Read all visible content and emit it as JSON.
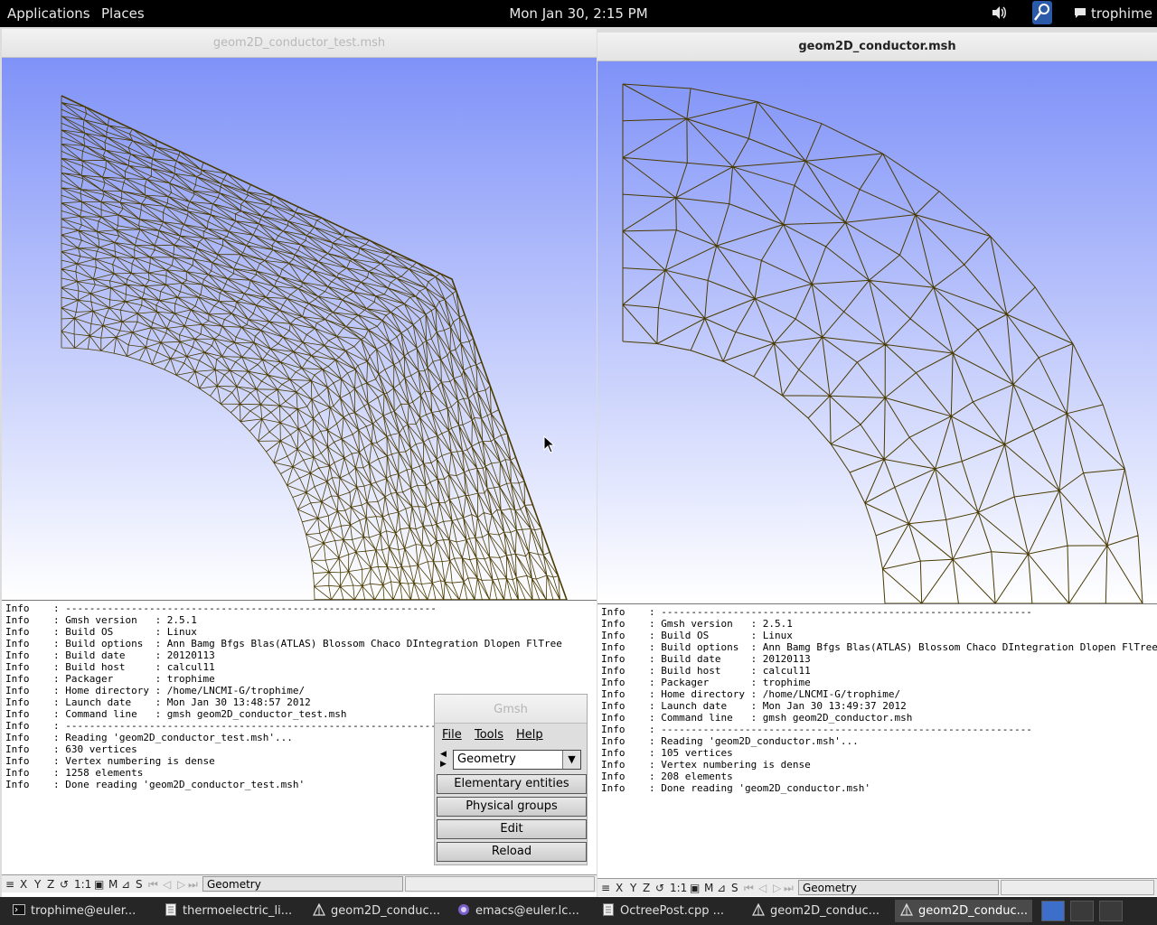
{
  "topbar": {
    "applications": "Applications",
    "places": "Places",
    "clock": "Mon Jan 30,  2:15 PM",
    "user": "trophime"
  },
  "left_window": {
    "title": "geom2D_conductor_test.msh",
    "console": [
      "Info    : --------------------------------------------------------------",
      "Info    : Gmsh version   : 2.5.1",
      "Info    : Build OS       : Linux",
      "Info    : Build options  : Ann Bamg Bfgs Blas(ATLAS) Blossom Chaco DIntegration Dlopen FlTree",
      "Info    : Build date     : 20120113",
      "Info    : Build host     : calcul11",
      "Info    : Packager       : trophime",
      "Info    : Home directory : /home/LNCMI-G/trophime/",
      "Info    : Launch date    : Mon Jan 30 13:48:57 2012",
      "Info    : Command line   : gmsh geom2D_conductor_test.msh",
      "Info    : --------------------------------------------------------------",
      "Info    : Reading 'geom2D_conductor_test.msh'...",
      "Info    : 630 vertices",
      "Info    : Vertex numbering is dense",
      "Info    : 1258 elements",
      "Info    : Done reading 'geom2D_conductor_test.msh'"
    ],
    "status_module": "Geometry"
  },
  "right_window": {
    "title": "geom2D_conductor.msh",
    "console": [
      "Info    : --------------------------------------------------------------",
      "Info    : Gmsh version   : 2.5.1",
      "Info    : Build OS       : Linux",
      "Info    : Build options  : Ann Bamg Bfgs Blas(ATLAS) Blossom Chaco DIntegration Dlopen FlTree",
      "Info    : Build date     : 20120113",
      "Info    : Build host     : calcul11",
      "Info    : Packager       : trophime",
      "Info    : Home directory : /home/LNCMI-G/trophime/",
      "Info    : Launch date    : Mon Jan 30 13:49:37 2012",
      "Info    : Command line   : gmsh geom2D_conductor.msh",
      "Info    : --------------------------------------------------------------",
      "Info    : Reading 'geom2D_conductor.msh'...",
      "Info    : 105 vertices",
      "Info    : Vertex numbering is dense",
      "Info    : 208 elements",
      "Info    : Done reading 'geom2D_conductor.msh'"
    ],
    "status_module": "Geometry"
  },
  "statusbar": {
    "x": "X",
    "y": "Y",
    "z": "Z",
    "rotate": "↺",
    "scale": "1:1",
    "m": "M",
    "s": "S",
    "first": "⏮",
    "prev": "◁",
    "play": "▷",
    "last": "⏭"
  },
  "gmsh_panel": {
    "title": "Gmsh",
    "menu_file": "File",
    "menu_tools": "Tools",
    "menu_help": "Help",
    "module": "Geometry",
    "buttons": [
      "Elementary entities",
      "Physical groups",
      "Edit",
      "Reload"
    ]
  },
  "taskbar": [
    {
      "label": "trophime@euler...",
      "icon": "terminal-icon"
    },
    {
      "label": "thermoelectric_li...",
      "icon": "document-icon"
    },
    {
      "label": "geom2D_conduc...",
      "icon": "gmsh-icon"
    },
    {
      "label": "emacs@euler.lc...",
      "icon": "emacs-icon"
    },
    {
      "label": "OctreePost.cpp ...",
      "icon": "document-icon"
    },
    {
      "label": "geom2D_conduc...",
      "icon": "gmsh-icon"
    },
    {
      "label": "geom2D_conduc...",
      "icon": "gmsh-icon"
    }
  ],
  "colors": {
    "mesh": "#4a3a00",
    "gradient_top": "#7f92f8",
    "gradient_bottom": "#ffffff"
  }
}
